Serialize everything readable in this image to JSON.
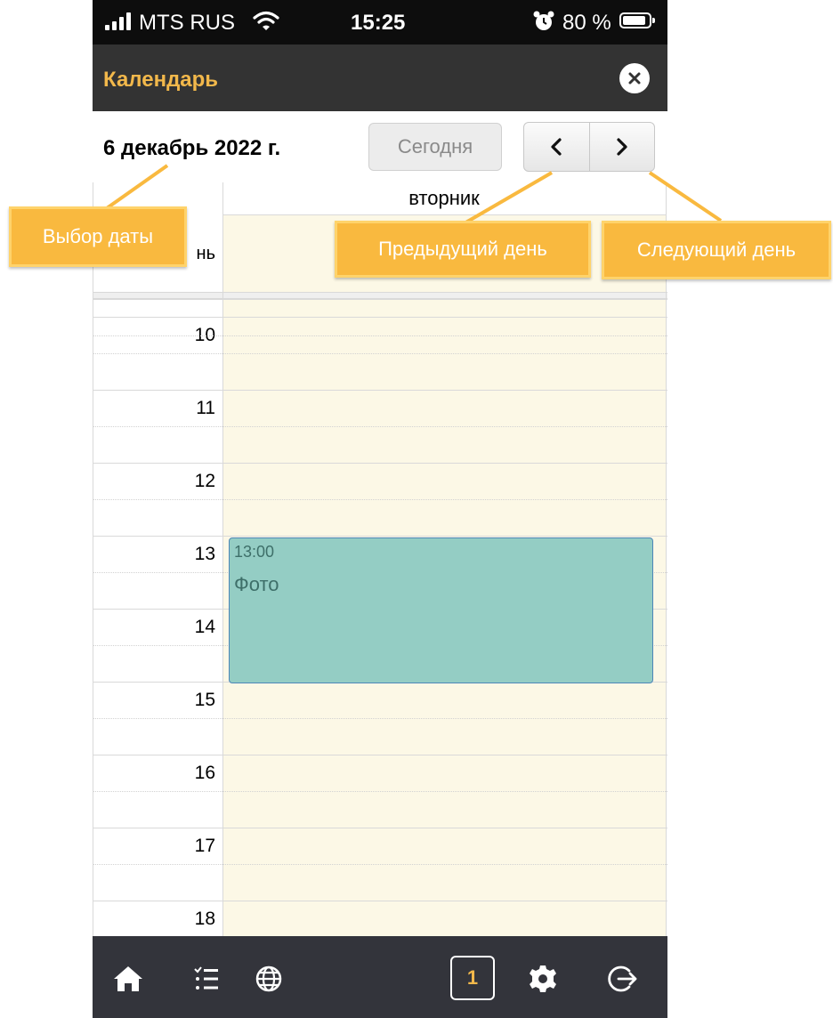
{
  "status_bar": {
    "carrier": "MTS RUS",
    "time": "15:25",
    "battery": "80 %"
  },
  "header": {
    "title": "Календарь",
    "close_icon": "close-icon"
  },
  "toolbar": {
    "date": "6 декабрь 2022 г.",
    "today_label": "Сегодня",
    "prev_icon": "chevron-left-icon",
    "next_icon": "chevron-right-icon"
  },
  "calendar": {
    "day_name": "вторник",
    "allday_label": "нь",
    "hours": [
      "10",
      "11",
      "12",
      "13",
      "14",
      "15",
      "16",
      "17",
      "18"
    ],
    "event": {
      "time": "13:00",
      "title": "Фото",
      "color": "#94cdc4"
    }
  },
  "bottom_bar": {
    "icons": [
      "home-icon",
      "list-icon",
      "globe-icon",
      "calendar-day-icon",
      "gear-icon",
      "logout-icon"
    ],
    "badge": "1",
    "badge_color": "#f2b84b"
  },
  "annotations": {
    "date_pick": "Выбор даты",
    "prev_day": "Предыдущий день",
    "next_day": "Следующий день"
  },
  "colors": {
    "header_bg": "#333333",
    "accent": "#f2b84b",
    "day_bg": "#fcf8e6",
    "callout": "#f9b93f"
  }
}
